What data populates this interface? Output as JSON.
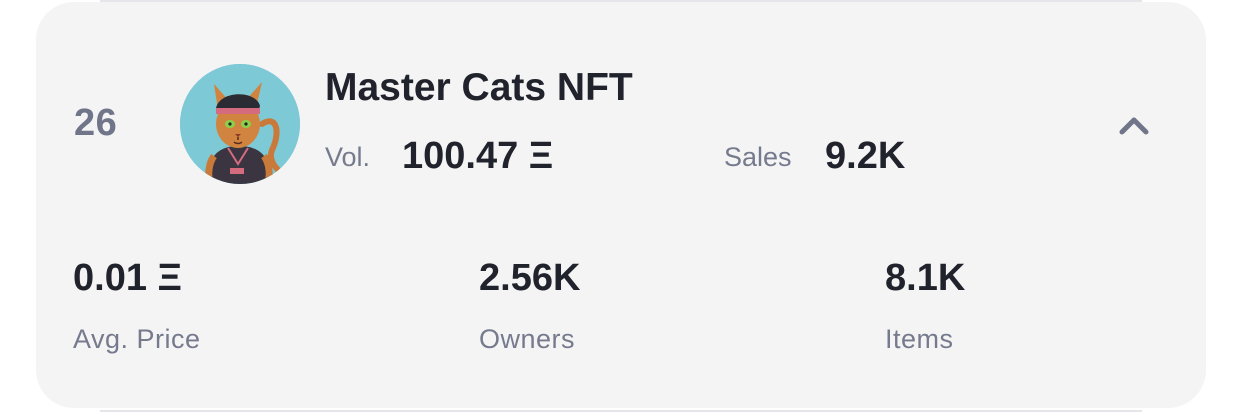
{
  "collection": {
    "rank": "26",
    "name": "Master Cats NFT",
    "avatar_icon": "cat-avatar-icon",
    "volume_label": "Vol.",
    "volume_value": "100.47 Ξ",
    "sales_label": "Sales",
    "sales_value": "9.2K",
    "toggle_icon": "chevron-up-icon"
  },
  "stats": {
    "avg_price_value": "0.01 Ξ",
    "avg_price_label": "Avg. Price",
    "owners_value": "2.56K",
    "owners_label": "Owners",
    "items_value": "8.1K",
    "items_label": "Items"
  },
  "colors": {
    "card_background": "#f4f4f5",
    "primary_text": "#20232c",
    "secondary_text": "#767a8d",
    "avatar_background": "#7ec9d6"
  }
}
